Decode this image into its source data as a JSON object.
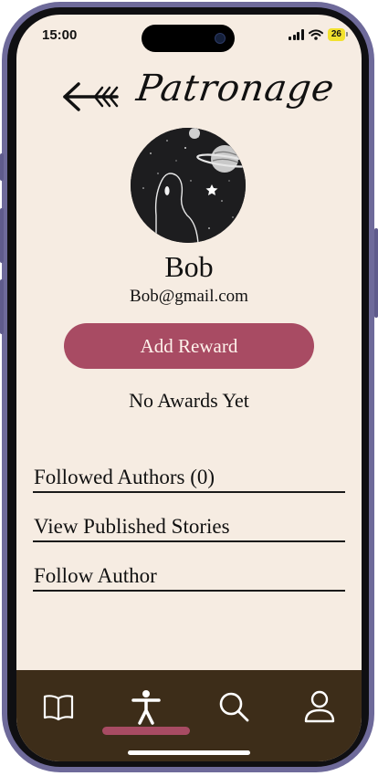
{
  "status_bar": {
    "time": "15:00",
    "battery": "26"
  },
  "header": {
    "title": "Patronage"
  },
  "profile": {
    "name": "Bob",
    "email": "Bob@gmail.com",
    "add_reward_label": "Add Reward",
    "awards_text": "No Awards Yet"
  },
  "menu": {
    "items": [
      {
        "label": "Followed Authors (0)"
      },
      {
        "label": "View Published Stories"
      },
      {
        "label": "Follow Author"
      }
    ]
  },
  "tab_bar": {
    "tabs": [
      {
        "icon": "book-icon"
      },
      {
        "icon": "person-icon",
        "active": true
      },
      {
        "icon": "search-icon"
      },
      {
        "icon": "user-icon"
      }
    ],
    "active_color": "#a84b63",
    "background": "#3d2d19"
  },
  "colors": {
    "accent": "#a84b63",
    "background": "#f6ece2"
  }
}
